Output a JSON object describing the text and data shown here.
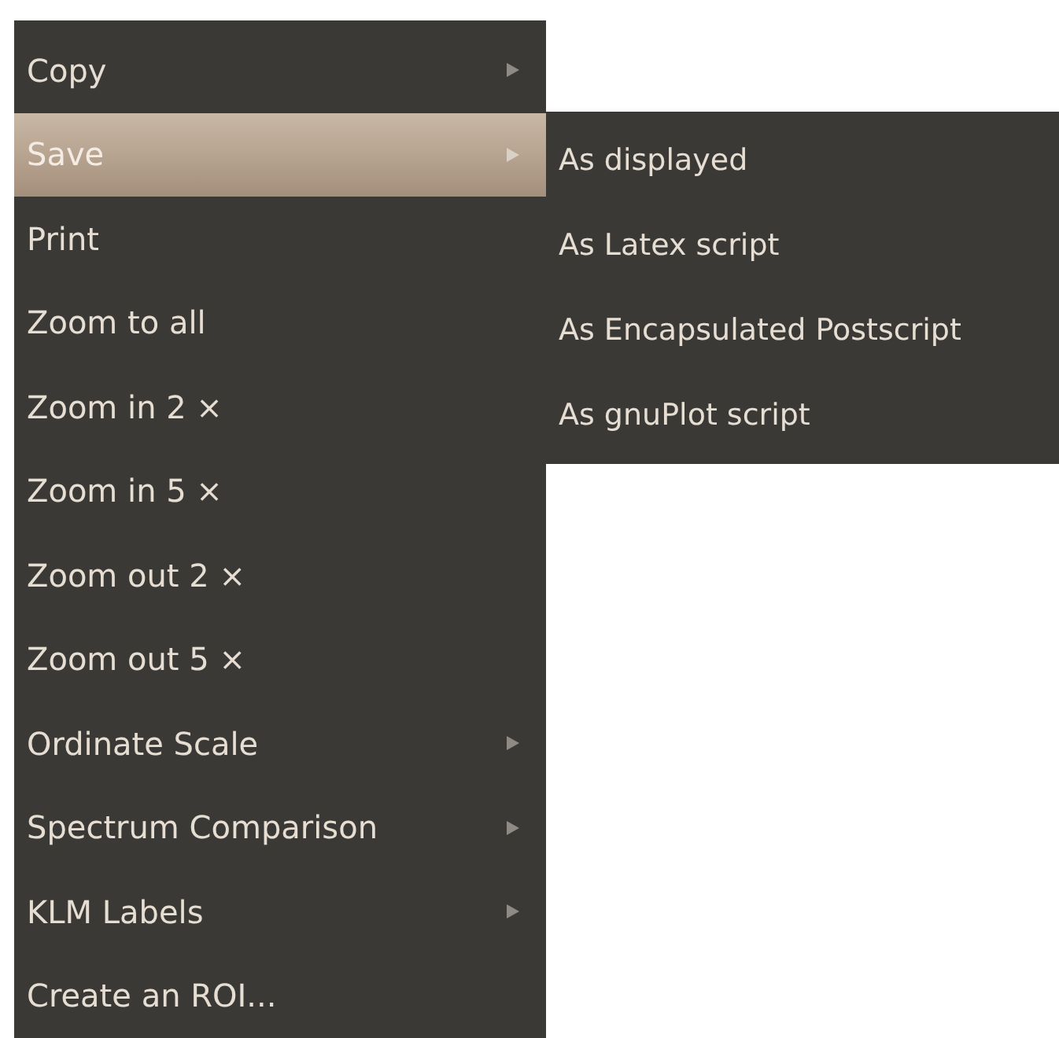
{
  "menu": {
    "items": [
      {
        "label": "Copy",
        "submenu": true,
        "selected": false
      },
      {
        "label": "Save",
        "submenu": true,
        "selected": true
      },
      {
        "label": "Print",
        "submenu": false,
        "selected": false
      },
      {
        "label": "Zoom to all",
        "submenu": false,
        "selected": false
      },
      {
        "label": "Zoom in 2 ×",
        "submenu": false,
        "selected": false
      },
      {
        "label": "Zoom in 5 ×",
        "submenu": false,
        "selected": false
      },
      {
        "label": "Zoom out 2 ×",
        "submenu": false,
        "selected": false
      },
      {
        "label": "Zoom out 5 ×",
        "submenu": false,
        "selected": false
      },
      {
        "label": "Ordinate Scale",
        "submenu": true,
        "selected": false
      },
      {
        "label": "Spectrum Comparison",
        "submenu": true,
        "selected": false
      },
      {
        "label": "KLM Labels",
        "submenu": true,
        "selected": false
      },
      {
        "label": "Create an ROI...",
        "submenu": false,
        "selected": false
      }
    ]
  },
  "submenu": {
    "items": [
      {
        "label": "As displayed"
      },
      {
        "label": "As Latex script"
      },
      {
        "label": "As Encapsulated Postscript"
      },
      {
        "label": "As gnuPlot script"
      }
    ]
  }
}
